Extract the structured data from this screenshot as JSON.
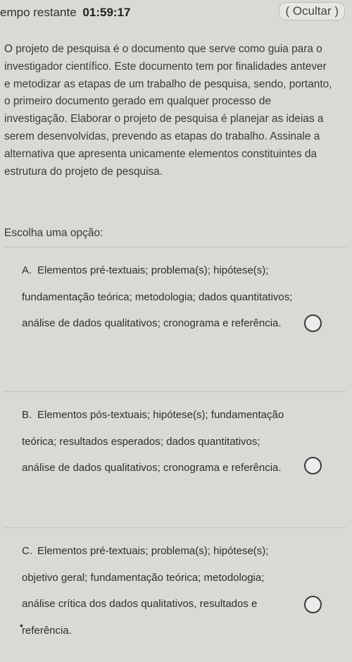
{
  "header": {
    "timer_label": "empo restante",
    "timer_value": "01:59:17",
    "hide_button": "( Ocultar )"
  },
  "question": {
    "text": "O projeto de pesquisa é o documento que serve como guia para o investigador científico. Este documento tem por finalidades antever e metodizar as etapas de um trabalho de pesquisa, sendo, portanto, o primeiro documento gerado em qualquer processo de investigação. Elaborar o projeto de pesquisa é planejar as ideias a serem desenvolvidas, prevendo as etapas do trabalho. Assinale a alternativa que apresenta unicamente elementos constituintes da estrutura do projeto de pesquisa.",
    "prompt": "Escolha uma opção:"
  },
  "options": [
    {
      "letter": "A.",
      "text": "Elementos pré-textuais; problema(s); hipótese(s); fundamentação teórica; metodologia; dados quantitativos; análise de dados qualitativos; cronograma e referência.",
      "selected": false
    },
    {
      "letter": "B.",
      "text": "Elementos pós-textuais; hipótese(s); fundamentação teórica; resultados esperados; dados quantitativos; análise de dados qualitativos; cronograma e referência.",
      "selected": false
    },
    {
      "letter": "C.",
      "text": "Elementos pré-textuais; problema(s); hipótese(s); objetivo geral; fundamentação teórica; metodologia; análise crítica dos dados qualitativos, resultados e referência.",
      "selected": false
    }
  ],
  "marks": {
    "stray_dot": "•"
  },
  "colors": {
    "background": "#d9d9d5",
    "text": "#2e2e2e",
    "radio_border": "#3c3c3c"
  }
}
